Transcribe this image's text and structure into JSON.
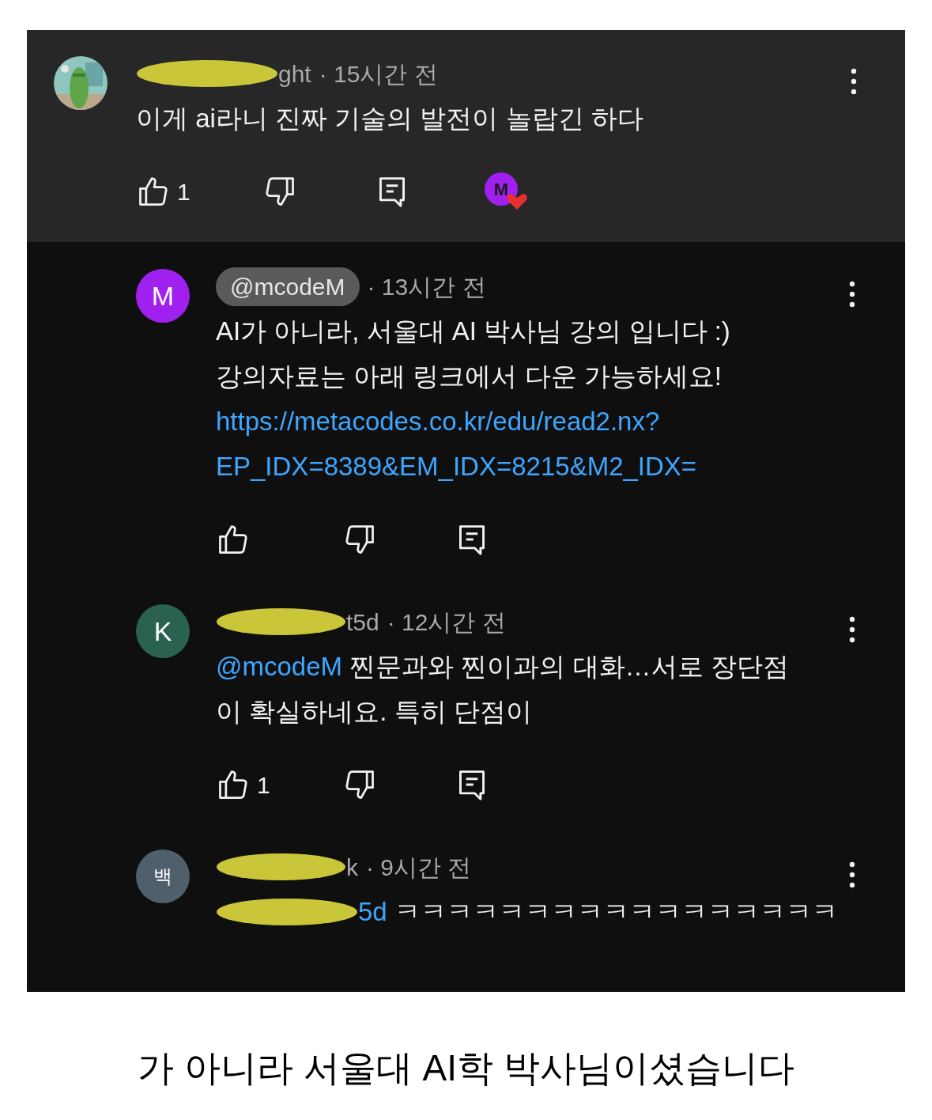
{
  "comment": {
    "avatar": {
      "kind": "picture"
    },
    "author": {
      "redacted": true,
      "visible": "ght",
      "highlighted": false
    },
    "time": "· 15시간 전",
    "lines": [
      [
        {
          "kind": "text",
          "text": "이게 ai라니 진짜 기술의 발전이 놀랍긴 하다"
        }
      ]
    ],
    "likes": "1",
    "actions_shown": true,
    "creator_hearted": true,
    "creator_initial": "M"
  },
  "replies": [
    {
      "avatar": {
        "kind": "letter",
        "text": "M",
        "color": "#a020f0"
      },
      "author": {
        "redacted": false,
        "visible": "@mcodeM",
        "highlighted": true
      },
      "time": "· 13시간 전",
      "lines": [
        [
          {
            "kind": "text",
            "text": "AI가 아니라, 서울대 AI 박사님 강의 입니다 :)"
          }
        ],
        [
          {
            "kind": "text",
            "text": "강의자료는 아래 링크에서 다운 가능하세요!"
          }
        ],
        [
          {
            "kind": "link",
            "text": "https://metacodes.co.kr/edu/read2.nx?"
          }
        ],
        [
          {
            "kind": "link",
            "text": "EP_IDX=8389&EM_IDX=8215&M2_IDX="
          }
        ]
      ],
      "actions_shown": true
    },
    {
      "avatar": {
        "kind": "letter",
        "text": "K",
        "color": "#2b6150"
      },
      "author": {
        "redacted": true,
        "visible": "t5d",
        "highlighted": false
      },
      "time": "· 12시간 전",
      "lines": [
        [
          {
            "kind": "mention",
            "text": "@mcodeM"
          },
          {
            "kind": "text",
            "text": " 찐문과와 찐이과의 대화…서로 장단점"
          }
        ],
        [
          {
            "kind": "text",
            "text": "이 확실하네요. 특히 단점이"
          }
        ]
      ],
      "likes": "1",
      "actions_shown": true
    },
    {
      "avatar": {
        "kind": "letter",
        "text": "백",
        "color": "#4f5f6b"
      },
      "author": {
        "redacted": true,
        "visible": "k",
        "highlighted": false
      },
      "time": "· 9시간 전",
      "lines": [
        [
          {
            "kind": "redacted"
          },
          {
            "kind": "mention",
            "text": "5d"
          },
          {
            "kind": "text",
            "text": " ㅋㅋㅋㅋㅋㅋㅋㅋㅋㅋㅋㅋㅋㅋㅋㅋㅋ"
          }
        ]
      ],
      "actions_shown": false
    }
  ],
  "caption": "가 아니라 서울대 AI학 박사님이셨습니다"
}
